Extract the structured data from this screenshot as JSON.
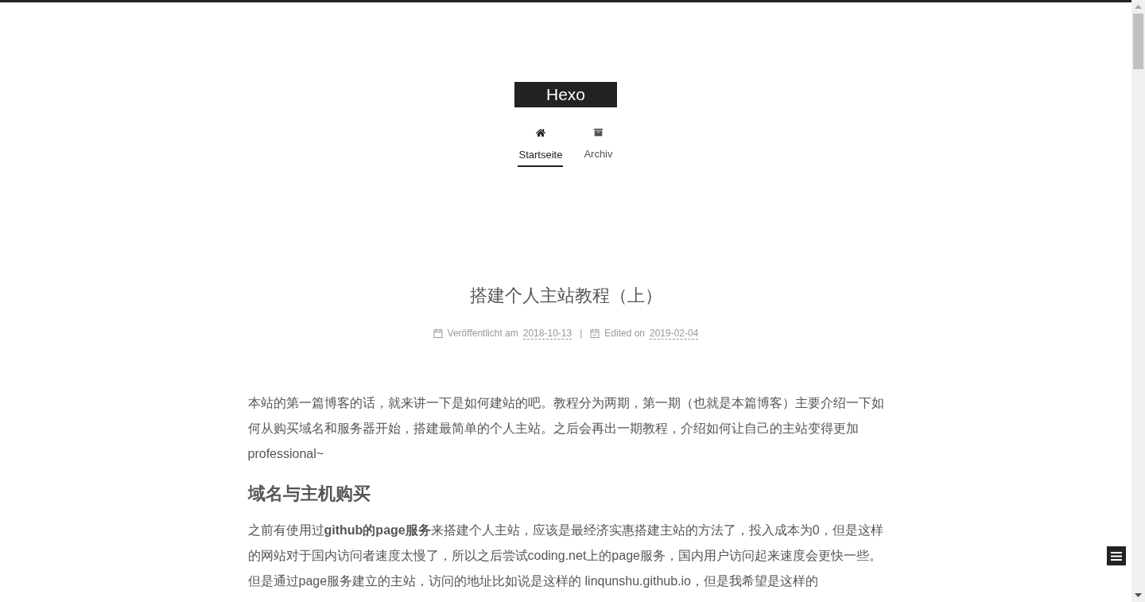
{
  "site": {
    "title": "Hexo"
  },
  "nav": [
    {
      "label": "Startseite",
      "kind": "home",
      "selected": true
    },
    {
      "label": "Archiv",
      "kind": "archive",
      "selected": false
    }
  ],
  "post": {
    "title": "搭建个人主站教程（上）",
    "meta": [
      {
        "kind": "published",
        "label": "Veröffentlicht am",
        "date": "2018-10-13"
      },
      {
        "kind": "edited",
        "label": "Edited on",
        "date": "2019-02-04"
      }
    ],
    "meta_separator": "|",
    "body": [
      {
        "kind": "paragraph",
        "text": "本站的第一篇博客的话，就来讲一下是如何建站的吧。教程分为两期，第一期（也就是本篇博客）主要介绍一下如何从购买域名和服务器开始，搭建最简单的个人主站。之后会再出一期教程，介绍如何让自己的主站变得更加professional~"
      },
      {
        "kind": "heading",
        "text": "域名与主机购买"
      },
      {
        "kind": "paragraph",
        "text": "之前有使用过**github的page服务**来搭建个人主站，应该是最经济实惠搭建主站的方法了，投入成本为0，但是这样的网站对于国内访问者速度太慢了，所以之后尝试coding.net上的page服务，国内用户访问起来速度会更快一些。但是通过page服务建立的主站，访问的地址比如说是这样的 linqunshu.github.io，但是我希望是这样的"
      }
    ]
  }
}
